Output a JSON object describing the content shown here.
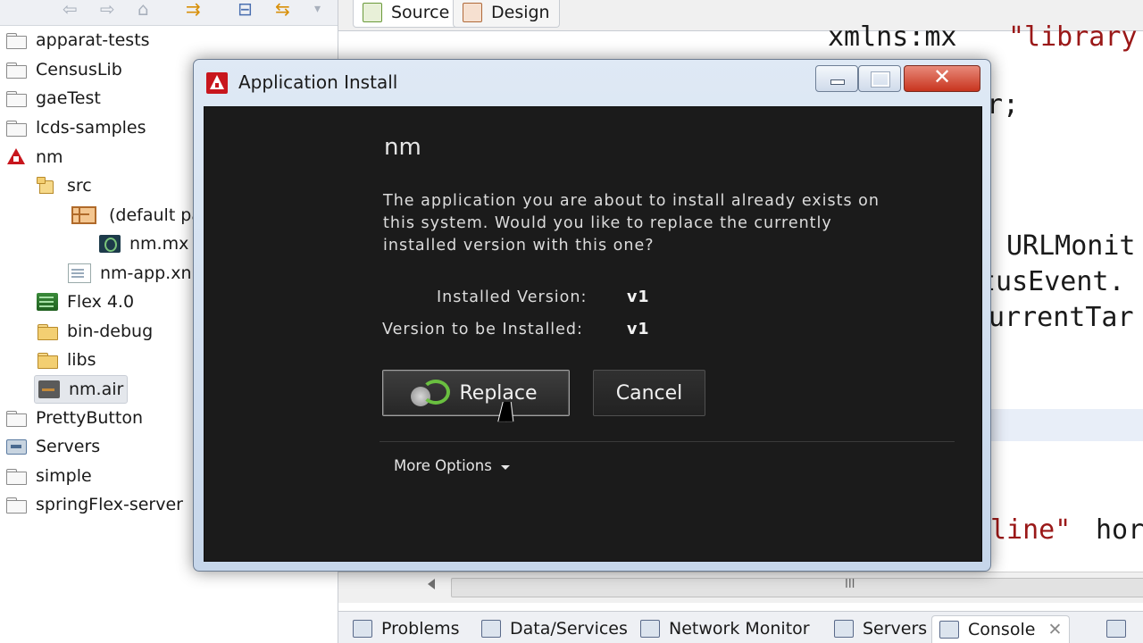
{
  "explorer": {
    "items": [
      {
        "label": "apparat-tests",
        "icon": "folder-icon"
      },
      {
        "label": "CensusLib",
        "icon": "folder-icon"
      },
      {
        "label": "gaeTest",
        "icon": "folder-icon"
      },
      {
        "label": "lcds-samples",
        "icon": "folder-icon"
      },
      {
        "label": "nm",
        "icon": "flex-project-icon"
      },
      {
        "label": "src",
        "icon": "source-folder-icon"
      },
      {
        "label": "(default pa",
        "icon": "package-icon"
      },
      {
        "label": "nm.mx",
        "icon": "mxml-file-icon"
      },
      {
        "label": "nm-app.xn",
        "icon": "xml-file-icon"
      },
      {
        "label": "Flex 4.0",
        "icon": "library-icon"
      },
      {
        "label": "bin-debug",
        "icon": "folder-icon"
      },
      {
        "label": "libs",
        "icon": "folder-icon"
      },
      {
        "label": "nm.air",
        "icon": "air-file-icon"
      },
      {
        "label": "PrettyButton",
        "icon": "folder-icon"
      },
      {
        "label": "Servers",
        "icon": "servers-folder-icon"
      },
      {
        "label": "simple",
        "icon": "folder-icon"
      },
      {
        "label": "springFlex-server",
        "icon": "folder-icon"
      }
    ]
  },
  "editor": {
    "tabs": [
      "Source",
      "Design"
    ],
    "code": {
      "l1a": "xmlns:mx",
      "l1b": "\"library:",
      "l2": "r;",
      "l3": "URLMonit",
      "l4": "tusEvent.",
      "l5": "urrentTar",
      "l6a": "line\"",
      "l6b": "hor"
    },
    "scroll_glyph": "III",
    "bottom_tabs": [
      "Problems",
      "Data/Services",
      "Network Monitor",
      "Servers",
      "Console"
    ]
  },
  "dialog": {
    "title": "Application Install",
    "app_name": "nm",
    "message": [
      "The application you are about to install already exists on",
      "this system. Would you like to replace the currently",
      "installed version with this one?"
    ],
    "installed_label": "Installed Version:",
    "installed_value": "v1",
    "tobe_label": "Version to be Installed:",
    "tobe_value": "v1",
    "replace_label": "Replace",
    "cancel_label": "Cancel",
    "more_options_label": "More Options",
    "close_glyph": "✕"
  },
  "colors": {
    "dialog_body": "#1b1b1b",
    "title_bar": "#c6d6ea",
    "close_button": "#c8341e",
    "accent_red": "#c8161d"
  }
}
